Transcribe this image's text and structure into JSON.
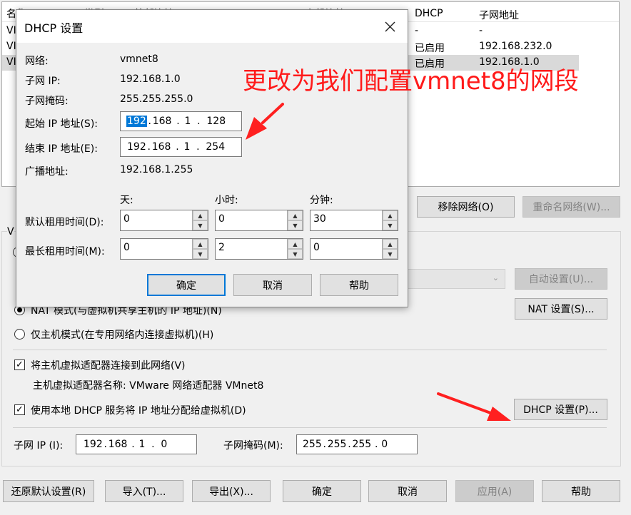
{
  "background_table": {
    "headers": [
      "名称",
      "类型",
      "外部连接",
      "主机连接",
      "DHCP",
      "子网地址"
    ],
    "rows": [
      {
        "name": "VI",
        "dhcp": "-",
        "subnet": "-"
      },
      {
        "name": "VI",
        "dhcp": "已启用",
        "subnet": "192.168.232.0"
      },
      {
        "name": "VI",
        "dhcp": "已启用",
        "subnet": "192.168.1.0"
      }
    ]
  },
  "network_buttons": {
    "remove": "移除网络(O)",
    "rename": "重命名网络(W)..."
  },
  "vmnet_group_prefix": "V",
  "bridge_auto_button": "自动设置(U)...",
  "nat_radio_label": "NAT 模式(与虚拟机共享主机的 IP 地址)(N)",
  "nat_settings_button": "NAT 设置(S)...",
  "hostonly_radio_label": "仅主机模式(在专用网络内连接虚拟机)(H)",
  "connect_adapter_label": "将主机虚拟适配器连接到此网络(V)",
  "adapter_name_text": "主机虚拟适配器名称: VMware 网络适配器 VMnet8",
  "use_dhcp_label": "使用本地 DHCP 服务将 IP 地址分配给虚拟机(D)",
  "dhcp_settings_button": "DHCP 设置(P)...",
  "subnet_ip_label": "子网 IP (I):",
  "subnet_ip": [
    "192",
    "168",
    "1",
    "0"
  ],
  "subnet_mask_label": "子网掩码(M):",
  "subnet_mask": [
    "255",
    "255",
    "255",
    "0"
  ],
  "bottom_buttons": {
    "restore": "还原默认设置(R)",
    "import": "导入(T)...",
    "export": "导出(X)...",
    "ok": "确定",
    "cancel": "取消",
    "apply": "应用(A)",
    "help": "帮助"
  },
  "dialog": {
    "title": "DHCP 设置",
    "network_label": "网络:",
    "network_value": "vmnet8",
    "subnet_label": "子网 IP:",
    "subnet_value": "192.168.1.0",
    "mask_label": "子网掩码:",
    "mask_value": "255.255.255.0",
    "start_label": "起始 IP 地址(S):",
    "start_ip": [
      "192",
      "168",
      "1",
      "128"
    ],
    "end_label": "结束 IP 地址(E):",
    "end_ip": [
      "192",
      "168",
      "1",
      "254"
    ],
    "broadcast_label": "广播地址:",
    "broadcast_value": "192.168.1.255",
    "col_days": "天:",
    "col_hours": "小时:",
    "col_minutes": "分钟:",
    "default_lease_label": "默认租用时间(D):",
    "default_lease": [
      "0",
      "0",
      "30"
    ],
    "max_lease_label": "最长租用时间(M):",
    "max_lease": [
      "0",
      "2",
      "0"
    ],
    "ok": "确定",
    "cancel": "取消",
    "help": "帮助"
  },
  "annotation": {
    "text": "更改为我们配置vmnet8的网段",
    "color": "#ff1a1a"
  }
}
